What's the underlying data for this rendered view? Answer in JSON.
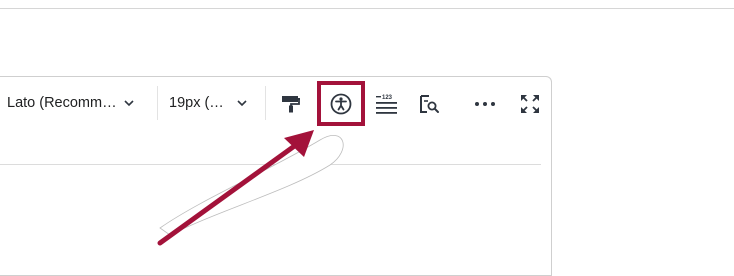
{
  "toolbar": {
    "font_family_value": "Lato (Recomm…",
    "font_size_value": "19px (…"
  },
  "icons": {
    "format_painter": "format-painter-icon",
    "accessibility_checker": "accessibility-icon",
    "word_count": "word-count-icon",
    "preview": "preview-search-icon",
    "more": "more-dots-icon",
    "fullscreen": "fullscreen-icon"
  },
  "annotation": {
    "highlight_color": "#a3123a",
    "arrow_color": "#a3123a",
    "highlighted_tool": "accessibility-checker-button"
  },
  "colors": {
    "icon": "#2f3640",
    "text": "#202122"
  }
}
